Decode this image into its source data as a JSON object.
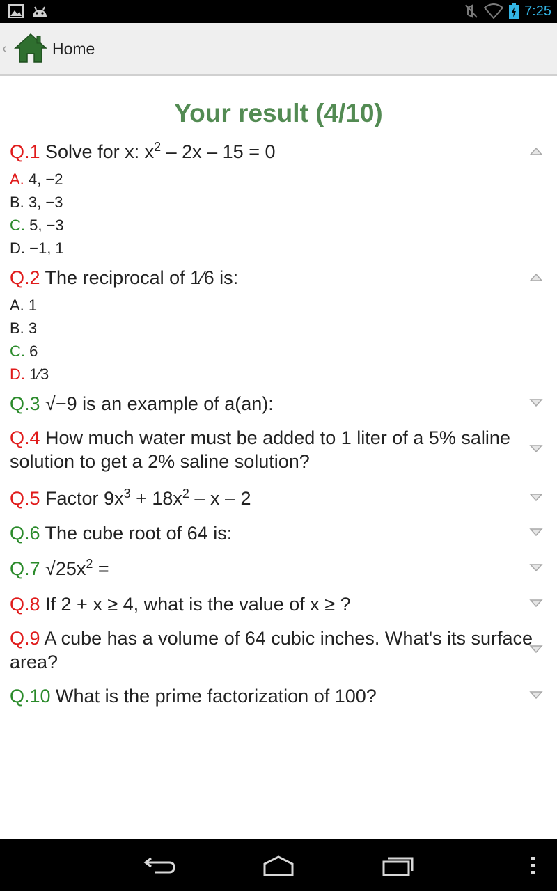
{
  "status_bar": {
    "time": "7:25",
    "icons": [
      "picture-icon",
      "android-icon",
      "mute-icon",
      "wifi-icon",
      "battery-charging-icon"
    ],
    "accent_color": "#33b5e5"
  },
  "action_bar": {
    "title": "Home",
    "logo": "home-icon"
  },
  "result": {
    "title": "Your result (4/10)"
  },
  "questions": [
    {
      "num": "Q.1",
      "num_color": "red",
      "text_pre": " Solve for x: x",
      "sup": "2",
      "text_post": " – 2x – 15 = 0",
      "expanded": true,
      "options": [
        {
          "letter": "A.",
          "color": "red",
          "text": " 4, −2"
        },
        {
          "letter": "B.",
          "color": "plain",
          "text": " 3, −3"
        },
        {
          "letter": "C.",
          "color": "green",
          "text": " 5, −3"
        },
        {
          "letter": "D.",
          "color": "plain",
          "text": " −1, 1"
        }
      ]
    },
    {
      "num": "Q.2",
      "num_color": "red",
      "text": " The reciprocal of 1⁄6 is:",
      "expanded": true,
      "options": [
        {
          "letter": "A.",
          "color": "plain",
          "text": " 1"
        },
        {
          "letter": "B.",
          "color": "plain",
          "text": " 3"
        },
        {
          "letter": "C.",
          "color": "green",
          "text": " 6"
        },
        {
          "letter": "D.",
          "color": "red",
          "text": " 1⁄3"
        }
      ]
    },
    {
      "num": "Q.3",
      "num_color": "green",
      "text": " √−9 is an example of a(an):",
      "expanded": false
    },
    {
      "num": "Q.4",
      "num_color": "red",
      "text": " How much water must be added to 1 liter of a 5% saline solution to get a 2% saline solution?",
      "expanded": false
    },
    {
      "num": "Q.5",
      "num_color": "red",
      "text_pre": " Factor 9x",
      "sup": "3",
      "text_mid": " + 18x",
      "sup2": "2",
      "text_post": " – x – 2",
      "expanded": false
    },
    {
      "num": "Q.6",
      "num_color": "green",
      "text": " The cube root of 64 is:",
      "expanded": false
    },
    {
      "num": "Q.7",
      "num_color": "green",
      "text_pre": " √25x",
      "sup": "2",
      "text_post": " =",
      "expanded": false
    },
    {
      "num": "Q.8",
      "num_color": "red",
      "text": " If 2 + x ≥ 4, what is the value of x ≥ ?",
      "expanded": false
    },
    {
      "num": "Q.9",
      "num_color": "red",
      "text": " A cube has a volume of 64 cubic inches. What's its surface area?",
      "expanded": false
    },
    {
      "num": "Q.10",
      "num_color": "green",
      "text": " What is the prime factorization of 100?",
      "expanded": false
    }
  ],
  "nav_bar": {
    "buttons": [
      "back-icon",
      "home-icon",
      "recent-apps-icon",
      "overflow-menu-icon"
    ]
  }
}
